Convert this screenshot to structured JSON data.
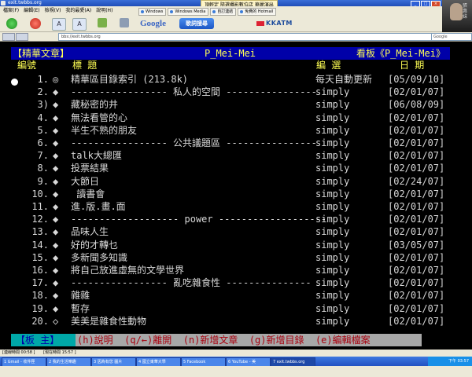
{
  "window": {
    "title": "exit.twbbs.org",
    "notice": "頂輕定 隨選攝影數位店  華麗演出"
  },
  "menu": [
    "檔案(F)",
    "編輯(E)",
    "檢視(V)",
    "我的最愛(A)",
    "說明(H)"
  ],
  "links": [
    "Windows",
    "Windows Media",
    "自訂連結",
    "免費的 Hotmail"
  ],
  "avatar": {
    "name": "張惠妹"
  },
  "toolbar": {
    "google_label": "Google",
    "search_label": "歌詞搜尋",
    "kkatm_label": "KKATM"
  },
  "address": {
    "url": "bbs://exit.twbbs.org",
    "search_placeholder": "Google"
  },
  "board": {
    "header_left": "【精華文章】",
    "header_center": "P_Mei-Mei",
    "header_right_prefix": "看板《",
    "header_right_board": "P_Mei-Mei",
    "header_right_suffix": "》",
    "col_num": "編號",
    "col_title": "標    題",
    "col_editor": "編  選",
    "col_date": "日  期",
    "rows": [
      {
        "num": "1.",
        "mark": "◎",
        "title": "精華區目錄索引 (213.8k)",
        "user": "每天自動更新",
        "date": "[05/09/10]"
      },
      {
        "num": "2.",
        "mark": "◆",
        "title": "----------------- 私人的空間 ----------------",
        "user": "simply",
        "date": "[02/01/07]"
      },
      {
        "num": "3)",
        "mark": "◆",
        "title": "藏秘密的井",
        "user": "simply",
        "date": "[06/08/09]"
      },
      {
        "num": "4.",
        "mark": "◆",
        "title": "無法看管的心",
        "user": "simply",
        "date": "[02/01/07]"
      },
      {
        "num": "5.",
        "mark": "◆",
        "title": "半生不熟的朋友",
        "user": "simply",
        "date": "[02/01/07]"
      },
      {
        "num": "6.",
        "mark": "◆",
        "title": "----------------- 公共議題區 ----------------",
        "user": "simply",
        "date": "[02/01/07]"
      },
      {
        "num": "7.",
        "mark": "◆",
        "title": "talk大總匯",
        "user": "simply",
        "date": "[02/01/07]"
      },
      {
        "num": "8.",
        "mark": "◆",
        "title": "投票結果",
        "user": "simply",
        "date": "[02/01/07]"
      },
      {
        "num": "9.",
        "mark": "◆",
        "title": "大節日",
        "user": "simply",
        "date": "[02/24/07]"
      },
      {
        "num": "10.",
        "mark": "◆",
        "title": " 讀書會",
        "user": "simply",
        "date": "[02/01/07]"
      },
      {
        "num": "11.",
        "mark": "◆",
        "title": "進.版.畫.面",
        "user": "simply",
        "date": "[02/01/07]"
      },
      {
        "num": "12.",
        "mark": "◆",
        "title": "------------------- power -------------------",
        "user": "simply",
        "date": "[02/01/07]"
      },
      {
        "num": "13.",
        "mark": "◆",
        "title": "品味人生",
        "user": "simply",
        "date": "[02/01/07]"
      },
      {
        "num": "14.",
        "mark": "◆",
        "title": "好的才轉乜",
        "user": "simply",
        "date": "[03/05/07]"
      },
      {
        "num": "15.",
        "mark": "◆",
        "title": "多新聞多知識",
        "user": "simply",
        "date": "[02/01/07]"
      },
      {
        "num": "16.",
        "mark": "◆",
        "title": "將自己放進虛無的文學世界",
        "user": "simply",
        "date": "[02/01/07]"
      },
      {
        "num": "17.",
        "mark": "◆",
        "title": "----------------- 亂吃雜食性 ---------------",
        "user": "simply",
        "date": "[02/01/07]"
      },
      {
        "num": "18.",
        "mark": "◆",
        "title": "雜雜",
        "user": "simply",
        "date": "[02/01/07]"
      },
      {
        "num": "19.",
        "mark": "◆",
        "title": "暫存",
        "user": "simply",
        "date": "[02/01/07]"
      },
      {
        "num": "20.",
        "mark": "◇",
        "title": "美美是雜食性動物",
        "user": "simply",
        "date": "[02/01/07]"
      }
    ],
    "footer_label": "【板  主】",
    "footer_keys": "(h)說明  (q/←)離開  (n)新增文章  (g)新增目錄  (e)編輯檔案"
  },
  "status": {
    "left": "[連線時間 00:58 ]",
    "mid": "[現在時間 15:57 ]"
  },
  "taskbar": {
    "items": [
      "1 Gmail - 收件匣",
      "2 我的生活樂趣",
      "3 因為有您 圖片",
      "4 國立東華大學",
      "5 Facebook",
      "6 YouTube - 美",
      "7 exit.twbbs.org"
    ],
    "clock": "下午 03:57"
  },
  "colors": {
    "header_bg": "#0000a8",
    "header_fg": "#ffff55",
    "footer_label_bg": "#00a8a8",
    "footer_bg": "#a8a8a8"
  }
}
